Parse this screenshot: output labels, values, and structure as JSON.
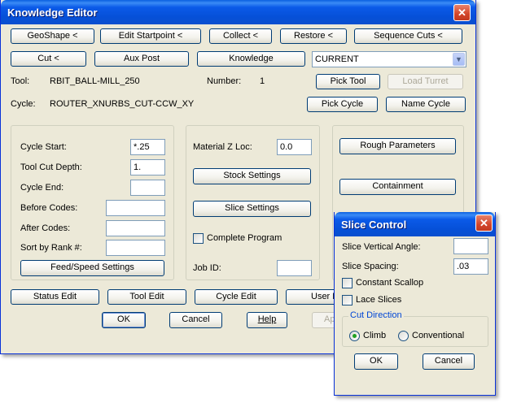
{
  "editor": {
    "title": "Knowledge Editor",
    "row1_buttons": [
      "GeoShape <",
      "Edit Startpoint <",
      "Collect <",
      "Restore <",
      "Sequence Cuts <"
    ],
    "row2_buttons": [
      "Cut <",
      "Aux Post",
      "Knowledge"
    ],
    "mode_select": "CURRENT",
    "tool_label": "Tool:",
    "tool_value": "RBIT_BALL-MILL_250",
    "number_label": "Number:",
    "number_value": "1",
    "pick_tool": "Pick Tool",
    "load_turret": "Load Turret",
    "cycle_label": "Cycle:",
    "cycle_value": "ROUTER_XNURBS_CUT-CCW_XY",
    "pick_cycle": "Pick Cycle",
    "name_cycle": "Name Cycle",
    "cycle_group": {
      "cycle_start_label": "Cycle Start:",
      "cycle_start_value": "*.25",
      "tool_cut_depth_label": "Tool Cut Depth:",
      "tool_cut_depth_value": "1.",
      "cycle_end_label": "Cycle End:",
      "cycle_end_value": "",
      "before_codes_label": "Before Codes:",
      "before_codes_value": "",
      "after_codes_label": "After Codes:",
      "after_codes_value": "",
      "sort_by_rank_label": "Sort by Rank #:",
      "sort_by_rank_value": "",
      "feed_speed_button": "Feed/Speed Settings"
    },
    "material_group": {
      "material_z_label": "Material Z Loc:",
      "material_z_value": "0.0",
      "stock_settings": "Stock Settings",
      "slice_settings": "Slice Settings",
      "complete_program": "Complete Program",
      "job_id_label": "Job ID:",
      "job_id_value": ""
    },
    "right_group": {
      "rough_parameters": "Rough Parameters",
      "containment": "Containment"
    },
    "bottom_buttons": [
      "Status Edit",
      "Tool Edit",
      "Cycle Edit",
      "User E"
    ],
    "ok": "OK",
    "cancel": "Cancel",
    "help": "Help",
    "apply": "Ap"
  },
  "slice": {
    "title": "Slice Control",
    "vertical_angle_label": "Slice Vertical Angle:",
    "vertical_angle_value": "",
    "spacing_label": "Slice Spacing:",
    "spacing_value": ".03",
    "constant_scallop": "Constant Scallop",
    "lace_slices": "Lace Slices",
    "cut_direction_legend": "Cut Direction",
    "climb": "Climb",
    "conventional": "Conventional",
    "ok": "OK",
    "cancel": "Cancel"
  }
}
